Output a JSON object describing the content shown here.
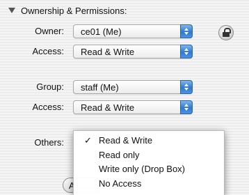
{
  "section": {
    "title": "Ownership & Permissions:"
  },
  "owner": {
    "label": "Owner:",
    "value": "ce01 (Me)"
  },
  "owner_access": {
    "label": "Access:",
    "value": "Read & Write"
  },
  "group": {
    "label": "Group:",
    "value": "staff (Me)"
  },
  "group_access": {
    "label": "Access:",
    "value": "Read & Write"
  },
  "others": {
    "label": "Others:"
  },
  "others_menu": {
    "check_glyph": "✓",
    "items": [
      {
        "label": "Read & Write",
        "checked": true
      },
      {
        "label": "Read only",
        "checked": false
      },
      {
        "label": "Write only (Drop Box)",
        "checked": false
      },
      {
        "label": "No Access",
        "checked": false
      }
    ]
  },
  "partial_button": {
    "label": "A"
  },
  "colors": {
    "stepper_blue": "#2f79d1",
    "panel_bg": "#ececec"
  }
}
